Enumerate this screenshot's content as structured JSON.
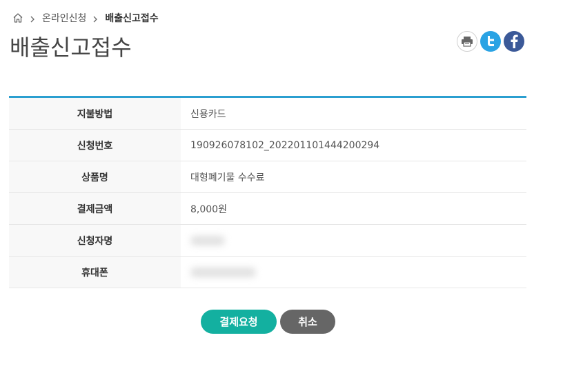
{
  "breadcrumb": {
    "home_icon": "home-icon",
    "items": [
      "온라인신청",
      "배출신고접수"
    ]
  },
  "page": {
    "title": "배출신고접수"
  },
  "share": {
    "icons": [
      "print-icon",
      "twitter-icon",
      "facebook-icon"
    ],
    "colors": {
      "twitter": "#2aa3e4",
      "facebook": "#3b5998"
    }
  },
  "table": {
    "accent_color": "#2b9fd0",
    "rows": [
      {
        "label": "지불방법",
        "value": "신용카드"
      },
      {
        "label": "신청번호",
        "value": "190926078102_202201101444200294"
      },
      {
        "label": "상품명",
        "value": "대형폐기물 수수료"
      },
      {
        "label": "결제금액",
        "value": "8,000원"
      },
      {
        "label": "신청자명",
        "value": ""
      },
      {
        "label": "휴대폰",
        "value": ""
      }
    ]
  },
  "buttons": {
    "pay_label": "결제요청",
    "cancel_label": "취소",
    "pay_color": "#13b0a0",
    "cancel_color": "#666666"
  }
}
